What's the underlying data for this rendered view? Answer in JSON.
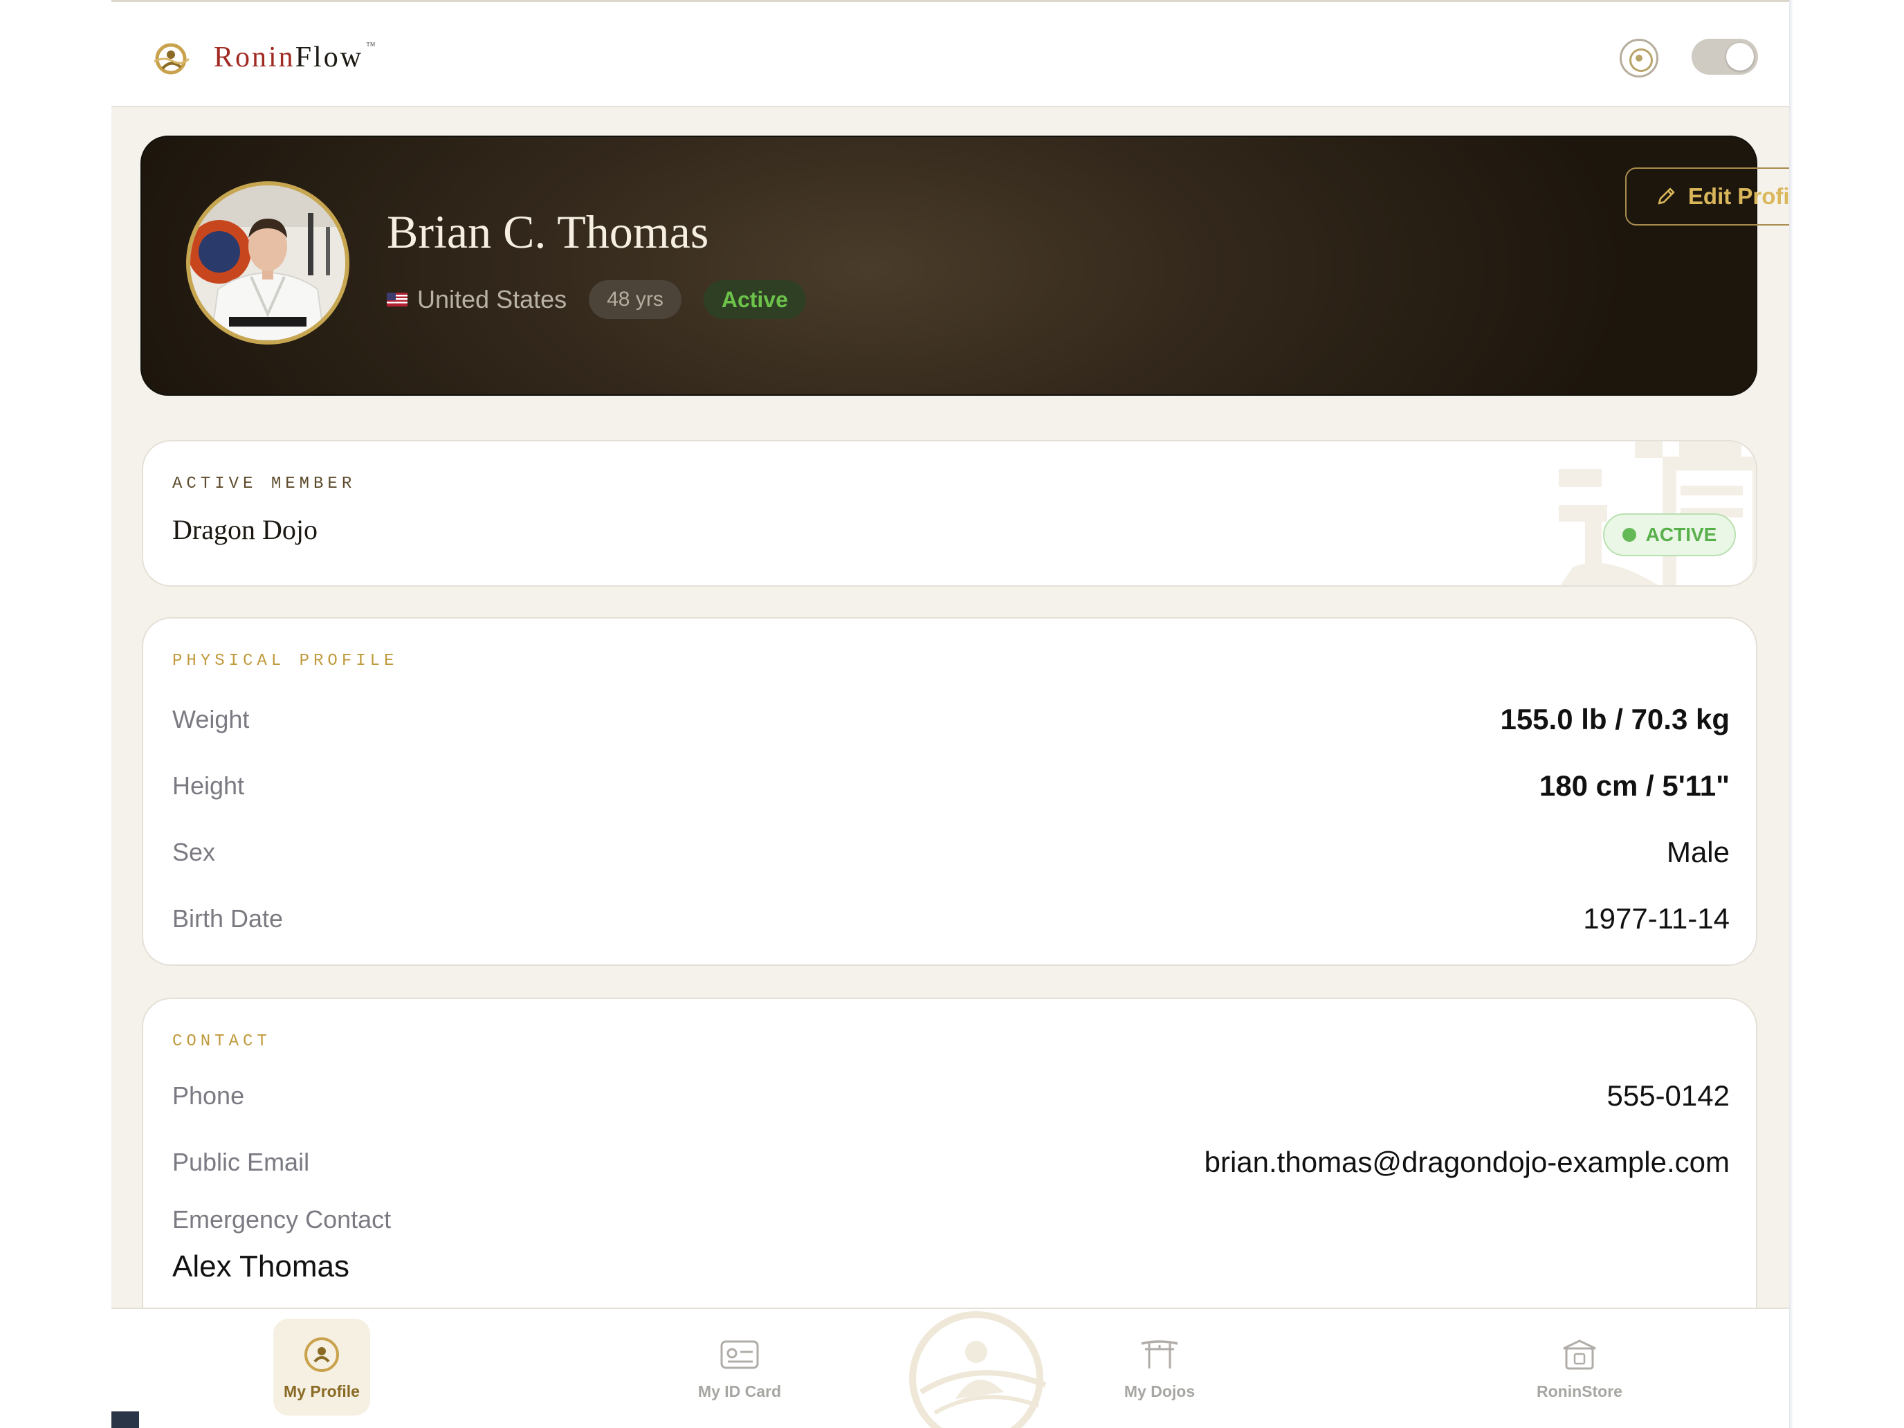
{
  "header": {
    "brand_part1": "Ronin",
    "brand_part2": "Flow",
    "trademark": "™"
  },
  "profile": {
    "name": "Brian C. Thomas",
    "country": "United States",
    "age": "48 yrs",
    "status": "Active",
    "edit_label": "Edit Profile"
  },
  "membership": {
    "label": "ACTIVE MEMBER",
    "dojo": "Dragon Dojo",
    "status": "ACTIVE"
  },
  "physical": {
    "label": "PHYSICAL PROFILE",
    "rows": [
      {
        "key": "Weight",
        "value": "155.0 lb / 70.3 kg"
      },
      {
        "key": "Height",
        "value": "180 cm / 5'11\""
      },
      {
        "key": "Sex",
        "value": "Male"
      },
      {
        "key": "Birth Date",
        "value": "1977-11-14"
      }
    ]
  },
  "contact": {
    "label": "CONTACT",
    "rows": [
      {
        "key": "Phone",
        "value": "555-0142"
      },
      {
        "key": "Public Email",
        "value": "brian.thomas@dragondojo-example.com"
      }
    ],
    "emergency_label": "Emergency Contact",
    "emergency_value": "Alex Thomas"
  },
  "nav": {
    "items": [
      {
        "label": "My Profile",
        "icon": "profile-icon",
        "active": true
      },
      {
        "label": "My ID Card",
        "icon": "id-card-icon",
        "active": false
      },
      {
        "label": "My Dojos",
        "icon": "dojo-gate-icon",
        "active": false
      },
      {
        "label": "RoninStore",
        "icon": "store-icon",
        "active": false
      }
    ]
  },
  "colors": {
    "accent_gold": "#c7a651",
    "brand_red": "#a02a22",
    "active_green": "#63b955",
    "hero_dark": "#2a2117",
    "page_bg": "#f5f2ec"
  }
}
